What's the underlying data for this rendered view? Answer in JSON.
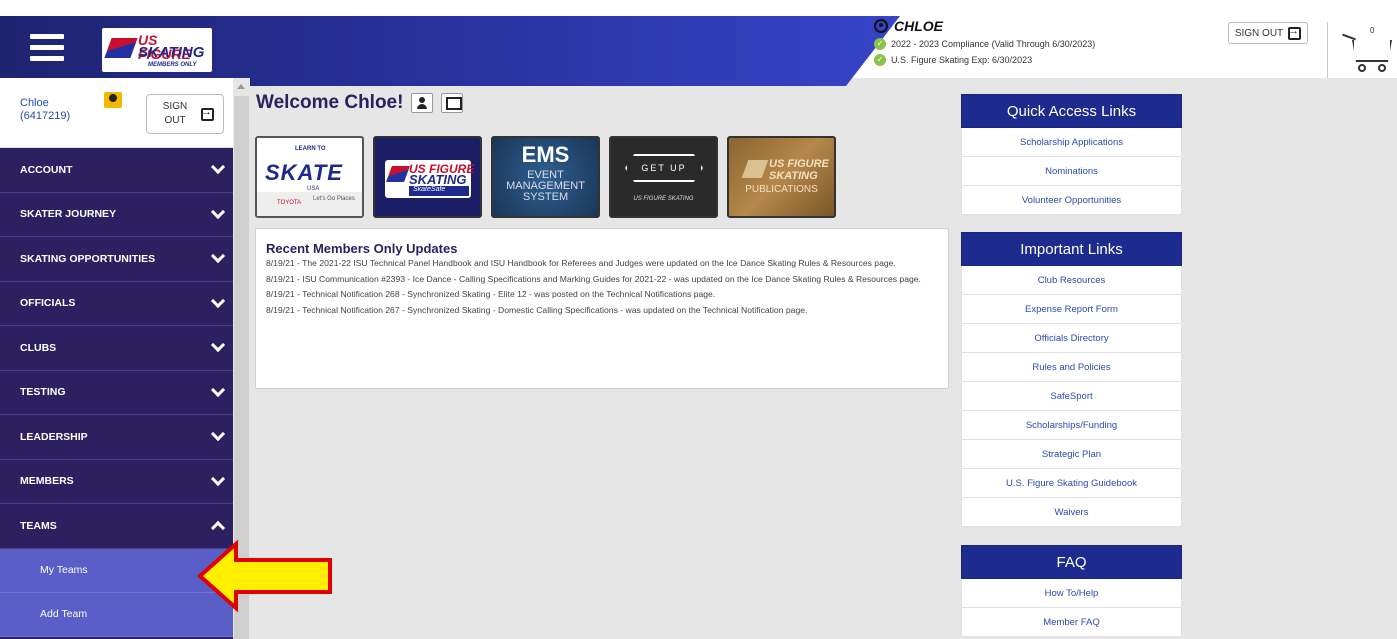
{
  "header": {
    "user_name": "CHLOE",
    "status": [
      "2022 - 2023 Compliance (Valid Through 6/30/2023)",
      "U.S. Figure Skating Exp: 6/30/2023"
    ],
    "sign_out": "SIGN OUT",
    "cart_count": "0",
    "logo": {
      "line1": "US FIGURE",
      "line2": "SKATING",
      "line3": "MEMBERS ONLY"
    }
  },
  "sidebar": {
    "user_name": "Chloe",
    "user_id": "(6417219)",
    "sign_out_line1": "SIGN",
    "sign_out_line2": "OUT",
    "nav": [
      {
        "label": "ACCOUNT",
        "expanded": false
      },
      {
        "label": "SKATER JOURNEY",
        "expanded": false
      },
      {
        "label": "SKATING OPPORTUNITIES",
        "expanded": false
      },
      {
        "label": "OFFICIALS",
        "expanded": false
      },
      {
        "label": "CLUBS",
        "expanded": false
      },
      {
        "label": "TESTING",
        "expanded": false
      },
      {
        "label": "LEADERSHIP",
        "expanded": false
      },
      {
        "label": "MEMBERS",
        "expanded": false
      },
      {
        "label": "TEAMS",
        "expanded": true
      }
    ],
    "teams_sub": [
      "My Teams",
      "Add Team"
    ]
  },
  "main": {
    "welcome": "Welcome Chloe!",
    "tiles": {
      "lts": {
        "small": "LEARN TO",
        "big": "SKATE",
        "usa": "USA",
        "toyota": "TOYOTA",
        "tagline": "Let's Go Places"
      },
      "safesport": {
        "t1": "US FIGURE",
        "t2": "SKATING",
        "t3": "SkateSafe"
      },
      "ems": {
        "t1": "EMS",
        "t2": "EVENT MANAGEMENT SYSTEM"
      },
      "getup": {
        "t1": "GET UP",
        "t2": "US FIGURE SKATING"
      },
      "pub": {
        "t1": "US FIGURE SKATING",
        "t2": "PUBLICATIONS"
      }
    },
    "updates_title": "Recent Members Only Updates",
    "updates": [
      "8/19/21 - The 2021-22 ISU Technical Panel Handbook and ISU Handbook for Referees and Judges were updated on the Ice Dance Skating Rules & Resources page.",
      "8/19/21 - ISU Communication #2393 - Ice Dance - Calling Specifications and Marking Guides for 2021-22 - was updated on the Ice Dance Skating Rules & Resources page.",
      "8/19/21 - Technical Notification 268 - Synchronized Skating - Elite 12 - was posted on the Technical Notifications page.",
      "8/19/21 - Technical Notification 267 - Synchronized Skating - Domestic Calling Specifications - was updated on the Technical Notification page."
    ]
  },
  "right": {
    "quick_title": "Quick Access Links",
    "quick_links": [
      "Scholarship Applications",
      "Nominations",
      "Volunteer Opportunities"
    ],
    "important_title": "Important Links",
    "important_links": [
      "Club Resources",
      "Expense Report Form",
      "Officials Directory",
      "Rules and Policies",
      "SafeSport",
      "Scholarships/Funding",
      "Strategic Plan",
      "U.S. Figure Skating Guidebook",
      "Waivers"
    ],
    "faq_title": "FAQ",
    "faq_links": [
      "How To/Help",
      "Member FAQ"
    ]
  },
  "colors": {
    "nav_bg": "#2d2060",
    "sub_bg": "#5a5fc8",
    "panel_head": "#1d2a8e",
    "arrow_fill": "#ffee00",
    "arrow_stroke": "#e00000"
  }
}
